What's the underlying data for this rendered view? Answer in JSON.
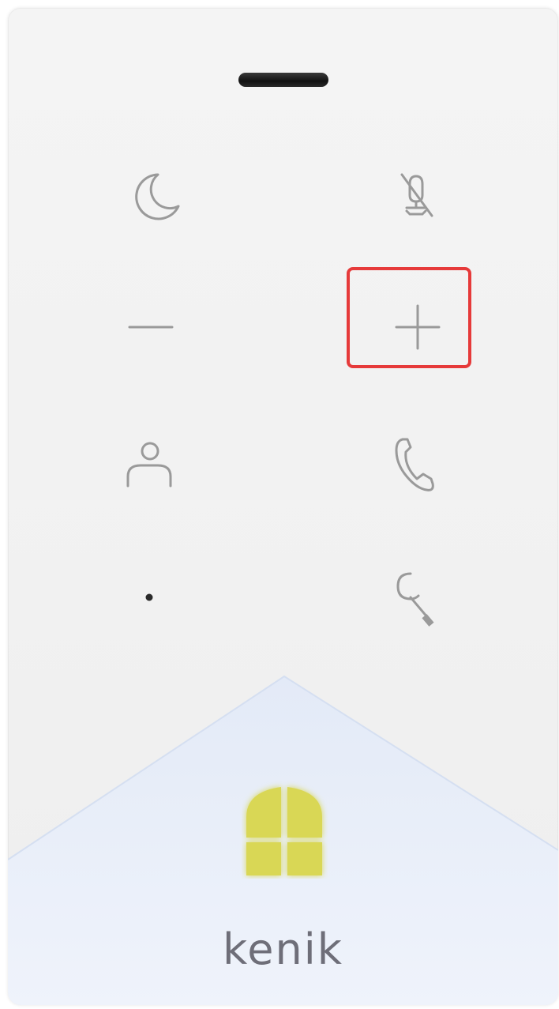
{
  "device": {
    "brand_name": "kenik",
    "body_color": "#f2f2f2",
    "icon_color": "#9a9a9a",
    "highlight_color": "#e63a3a",
    "door_panel_color": "#e8eef9",
    "door_lamp_color": "#d9d755"
  },
  "keypad": {
    "left_column": [
      {
        "name": "do-not-disturb",
        "icon": "moon-icon"
      },
      {
        "name": "volume-down",
        "icon": "minus-icon"
      },
      {
        "name": "contacts",
        "icon": "person-icon"
      },
      {
        "name": "status-led",
        "icon": "dot-indicator"
      }
    ],
    "right_column": [
      {
        "name": "microphone-mute",
        "icon": "mic-off-icon"
      },
      {
        "name": "volume-up",
        "icon": "plus-icon"
      },
      {
        "name": "call",
        "icon": "phone-icon"
      },
      {
        "name": "unlock",
        "icon": "key-icon"
      }
    ]
  },
  "selection": {
    "highlighted_button": "volume-up"
  }
}
